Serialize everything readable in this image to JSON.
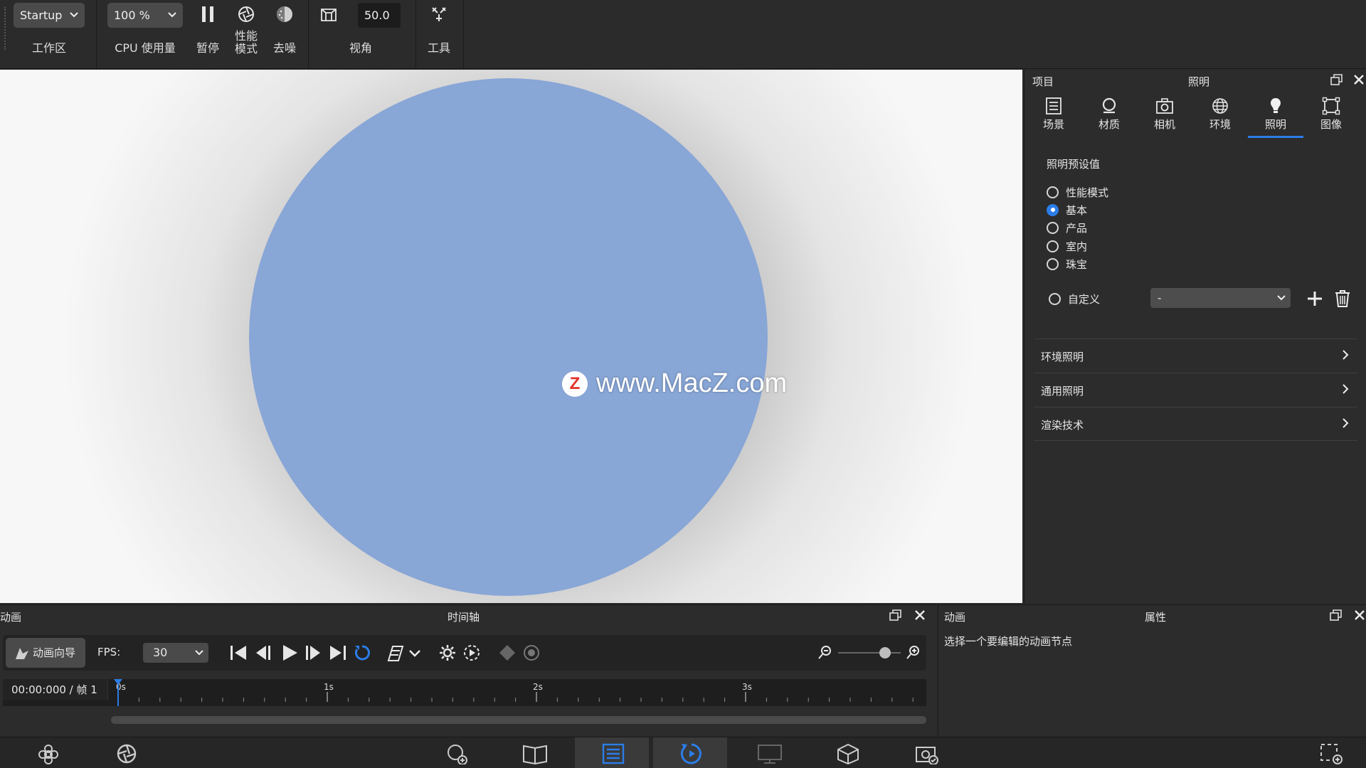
{
  "toolbar": {
    "workspace": {
      "value": "Startup",
      "label": "工作区"
    },
    "cpu": {
      "value": "100 %",
      "label": "CPU 使用量"
    },
    "pause_label": "暂停",
    "performance_label_1": "性能",
    "performance_label_2": "模式",
    "denoise_label": "去噪",
    "view": {
      "value": "50.0",
      "label": "视角"
    },
    "tools_label": "工具"
  },
  "viewport": {
    "watermark_text": "www.MacZ.com",
    "watermark_logo": "Z",
    "sphere_color": "#88a6d6"
  },
  "right_panel": {
    "left_title": "项目",
    "center_title": "照明",
    "tabs": [
      {
        "label": "场景",
        "icon": "scene-icon"
      },
      {
        "label": "材质",
        "icon": "material-icon"
      },
      {
        "label": "相机",
        "icon": "camera-icon"
      },
      {
        "label": "环境",
        "icon": "environment-icon"
      },
      {
        "label": "照明",
        "icon": "lighting-icon",
        "active": true
      },
      {
        "label": "图像",
        "icon": "image-icon"
      }
    ],
    "preset_title": "照明预设值",
    "presets": [
      {
        "label": "性能模式",
        "selected": false
      },
      {
        "label": "基本",
        "selected": true
      },
      {
        "label": "产品",
        "selected": false
      },
      {
        "label": "室内",
        "selected": false
      },
      {
        "label": "珠宝",
        "selected": false
      }
    ],
    "custom": {
      "label": "自定义",
      "select_value": "-"
    },
    "sections": [
      "环境照明",
      "通用照明",
      "渲染技术"
    ]
  },
  "animation_panel": {
    "left_title": "动画",
    "center_title": "时间轴",
    "wizard_label": "动画向导",
    "fps_label": "FPS:",
    "fps_value": "30",
    "time_readout": "00:00:000 / 帧 1",
    "ticks": [
      "0s",
      "1s",
      "2s",
      "3s"
    ]
  },
  "props_panel": {
    "left_title": "动画",
    "center_title": "属性",
    "message": "选择一个要编辑的动画节点"
  },
  "accent": "#2b7de9"
}
